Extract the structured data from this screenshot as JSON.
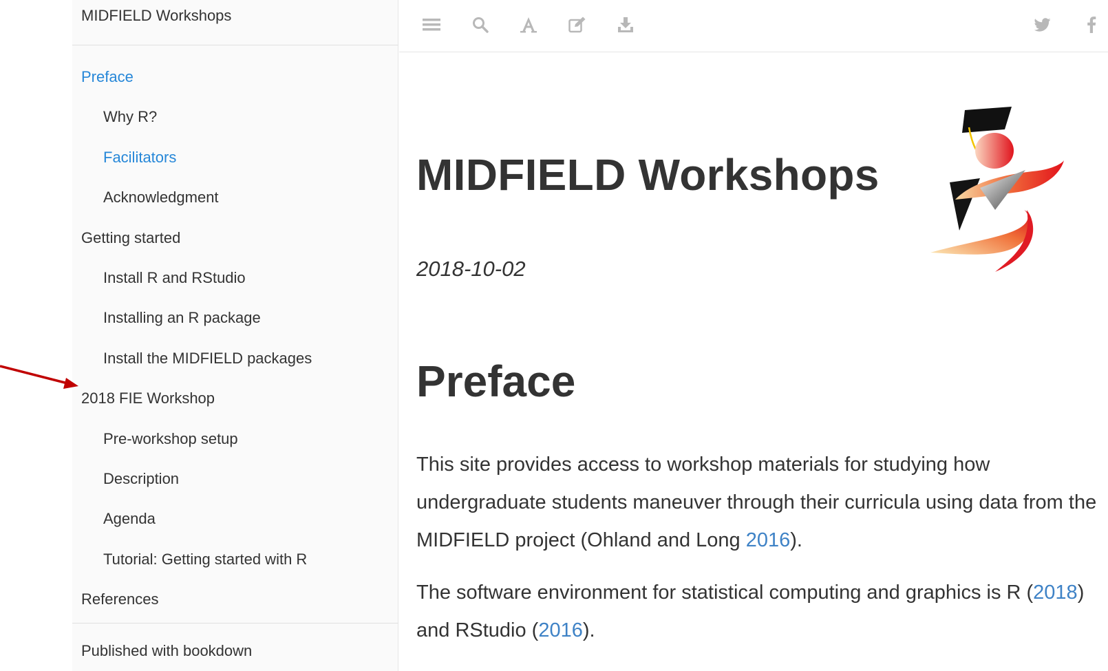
{
  "sidebar": {
    "title": "MIDFIELD Workshops",
    "items": [
      {
        "label": "Preface",
        "level": 1,
        "active": true
      },
      {
        "label": "Why R?",
        "level": 2,
        "active": false
      },
      {
        "label": "Facilitators",
        "level": 2,
        "active": true
      },
      {
        "label": "Acknowledgment",
        "level": 2,
        "active": false
      },
      {
        "label": "Getting started",
        "level": 1,
        "active": false
      },
      {
        "label": "Install R and RStudio",
        "level": 2,
        "active": false
      },
      {
        "label": "Installing an R package",
        "level": 2,
        "active": false
      },
      {
        "label": "Install the MIDFIELD packages",
        "level": 2,
        "active": false
      },
      {
        "label": "2018 FIE Workshop",
        "level": 1,
        "active": false
      },
      {
        "label": "Pre-workshop setup",
        "level": 2,
        "active": false
      },
      {
        "label": "Description",
        "level": 2,
        "active": false
      },
      {
        "label": "Agenda",
        "level": 2,
        "active": false
      },
      {
        "label": "Tutorial: Getting started with R",
        "level": 2,
        "active": false
      },
      {
        "label": "References",
        "level": 1,
        "active": false
      }
    ],
    "footer": "Published with bookdown"
  },
  "toolbar": {
    "left_icons": [
      "menu-icon",
      "search-icon",
      "font-icon",
      "edit-icon",
      "download-icon"
    ],
    "right_icons": [
      "twitter-icon",
      "facebook-icon"
    ],
    "icon_color": "#b8b8b8"
  },
  "main": {
    "title": "MIDFIELD Workshops",
    "date": "2018-10-02",
    "section_heading": "Preface",
    "paragraph1": {
      "text": "This site provides access to workshop materials for studying how undergraduate students maneuver through their curricula using data from the MIDFIELD project (Ohland and Long ",
      "link": "2016",
      "after": ")."
    },
    "paragraph2": {
      "text": "The software environment for statistical computing and graphics is R (",
      "link1": "2018",
      "middle": ") and RStudio (",
      "link2": "2016",
      "after": ")."
    }
  },
  "colors": {
    "link": "#3e82c6",
    "active_nav": "#2687d8",
    "annotation_arrow": "#c00000",
    "sidebar_bg": "#fafafa"
  }
}
